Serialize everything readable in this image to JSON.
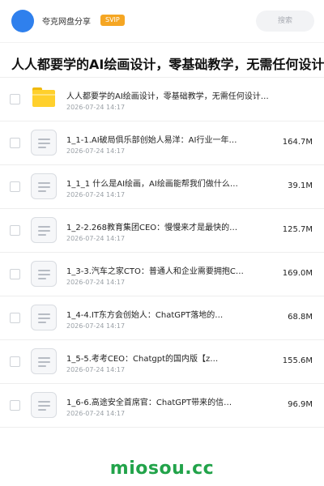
{
  "header": {
    "brand": "夸克网盘分享",
    "vip_badge": "SVIP",
    "search_placeholder": "搜索"
  },
  "page_title": "人人都要学的AI绘画设计，零基础教学，无需任何设计背景",
  "files": [
    {
      "type": "folder",
      "name": "人人都要学的AI绘画设计，零基础教学，无需任何设计…",
      "date": "2026-07-24 14:17",
      "size": ""
    },
    {
      "type": "file",
      "name": "1_1-1.AI破局俱乐部创始人易洋：AI行业一年…",
      "date": "2026-07-24 14:17",
      "size": "164.7M"
    },
    {
      "type": "file",
      "name": "1_1_1 什么是AI绘画，AI绘画能帮我们做什么…",
      "date": "2026-07-24 14:17",
      "size": "39.1M"
    },
    {
      "type": "file",
      "name": "1_2-2.268教育集团CEO：慢慢来才是最快的…",
      "date": "2026-07-24 14:17",
      "size": "125.7M"
    },
    {
      "type": "file",
      "name": "1_3-3.汽车之家CTO：普通人和企业需要拥抱C…",
      "date": "2026-07-24 14:17",
      "size": "169.0M"
    },
    {
      "type": "file",
      "name": "1_4-4.IT东方会创始人：ChatGPT落地的…",
      "date": "2026-07-24 14:17",
      "size": "68.8M"
    },
    {
      "type": "file",
      "name": "1_5-5.考考CEO：Chatgpt的国内版【z…",
      "date": "2026-07-24 14:17",
      "size": "155.6M"
    },
    {
      "type": "file",
      "name": "1_6-6.高途安全首席官：ChatGPT带来的信…",
      "date": "2026-07-24 14:17",
      "size": "96.9M"
    }
  ],
  "watermark": "miosou.cc",
  "colors": {
    "avatar": "#2f80ed",
    "vip": "#f5a623",
    "folder": "#ffd02c",
    "watermark": "#22a34a"
  }
}
